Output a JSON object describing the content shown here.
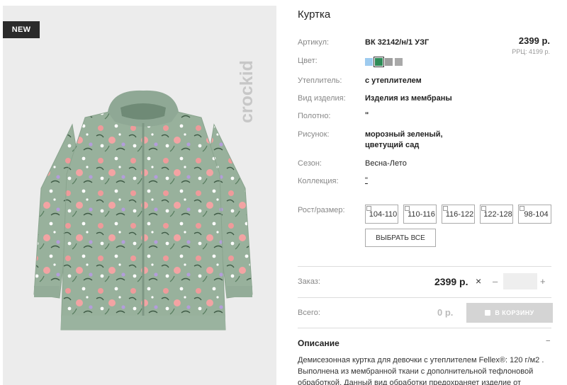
{
  "badge": "NEW",
  "brand": "crockid",
  "product": {
    "title": "Куртка",
    "price": "2399 р.",
    "rrp": "РРЦ: 4199 р.",
    "rows": [
      {
        "label": "Артикул:",
        "value": "ВК 32142/н/1 УЗГ"
      },
      {
        "label": "Цвет:",
        "value": ""
      },
      {
        "label": "Утеплитель:",
        "value": "с утеплителем"
      },
      {
        "label": "Вид изделия:",
        "value": "Изделия из мембраны"
      },
      {
        "label": "Полотно:",
        "value": "\""
      },
      {
        "label": "Рисунок:",
        "value": "морозный зеленый,"
      },
      {
        "label": "Сезон:",
        "value": "Весна-Лето"
      },
      {
        "label": "Коллекция:",
        "value": "\""
      },
      {
        "label": "Рост/размер:",
        "value": ""
      }
    ],
    "pattern_line2": "цветущий сад",
    "colors": [
      "#9ecbef",
      "#2e8b57",
      "#9e9e9e",
      "#a9a9a9"
    ]
  },
  "sizes": [
    "104-110",
    "110-116",
    "116-122",
    "122-128",
    "98-104"
  ],
  "select_all": "ВЫБРАТЬ ВСЕ",
  "order": {
    "label": "Заказ:",
    "price": "2399 р.",
    "times": "×",
    "minus": "–",
    "plus": "+"
  },
  "total": {
    "label": "Всего:",
    "value": "0 р.",
    "cart_button": "В КОРЗИНУ"
  },
  "description": {
    "title": "Описание",
    "toggle": "–",
    "text": "Демисезонная куртка для девочки с утеплителем Fellex®: 120 г/м2 . Выполнена из мембранной ткани с дополнительной тефлоновой обработкой. Данный вид обработки предохраняет изделие от"
  }
}
